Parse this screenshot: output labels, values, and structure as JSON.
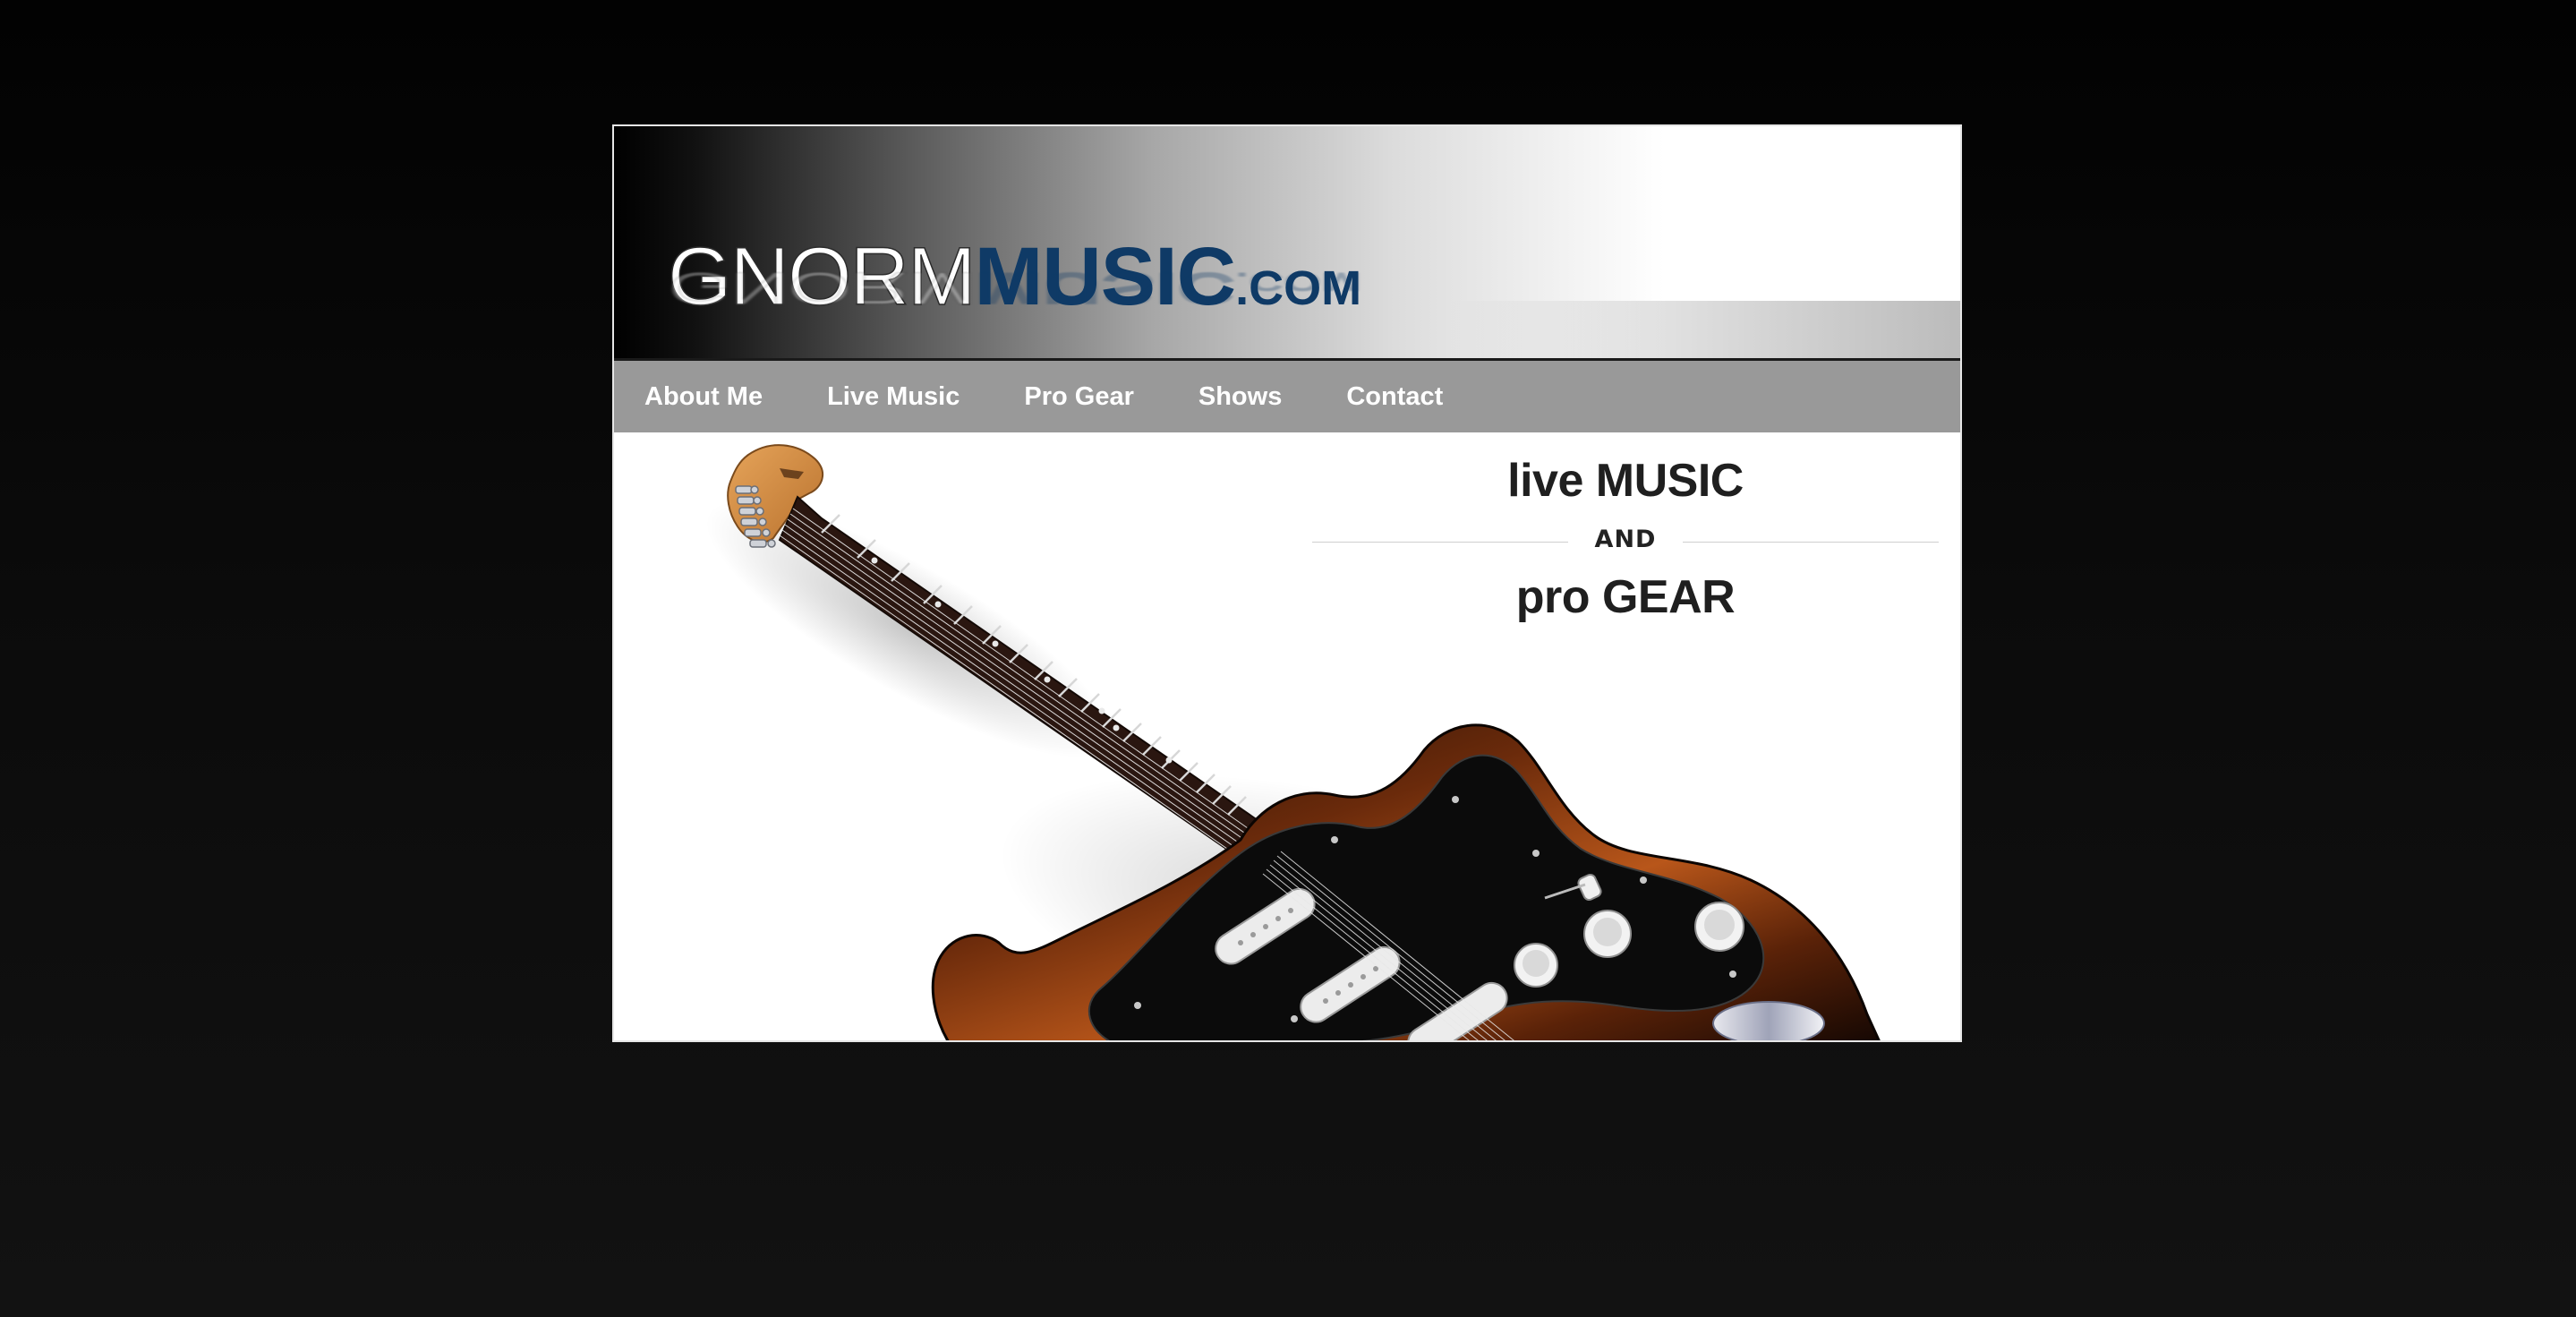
{
  "header": {
    "logo": {
      "part1": "GNORM",
      "part2": "MUSIC",
      "part3": ".COM"
    }
  },
  "nav": {
    "items": [
      {
        "label": "About Me"
      },
      {
        "label": "Live Music"
      },
      {
        "label": "Pro Gear"
      },
      {
        "label": "Shows"
      },
      {
        "label": "Contact"
      }
    ]
  },
  "hero": {
    "tagline": {
      "line1": "live MUSIC",
      "connector": "AND",
      "line2": "pro GEAR"
    },
    "image_subject": "electric-guitar"
  },
  "colors": {
    "page_background": "#0b0b0b",
    "nav_background": "#999999",
    "logo_blue": "#0f3a66",
    "text_dark": "#1f1f1f"
  }
}
